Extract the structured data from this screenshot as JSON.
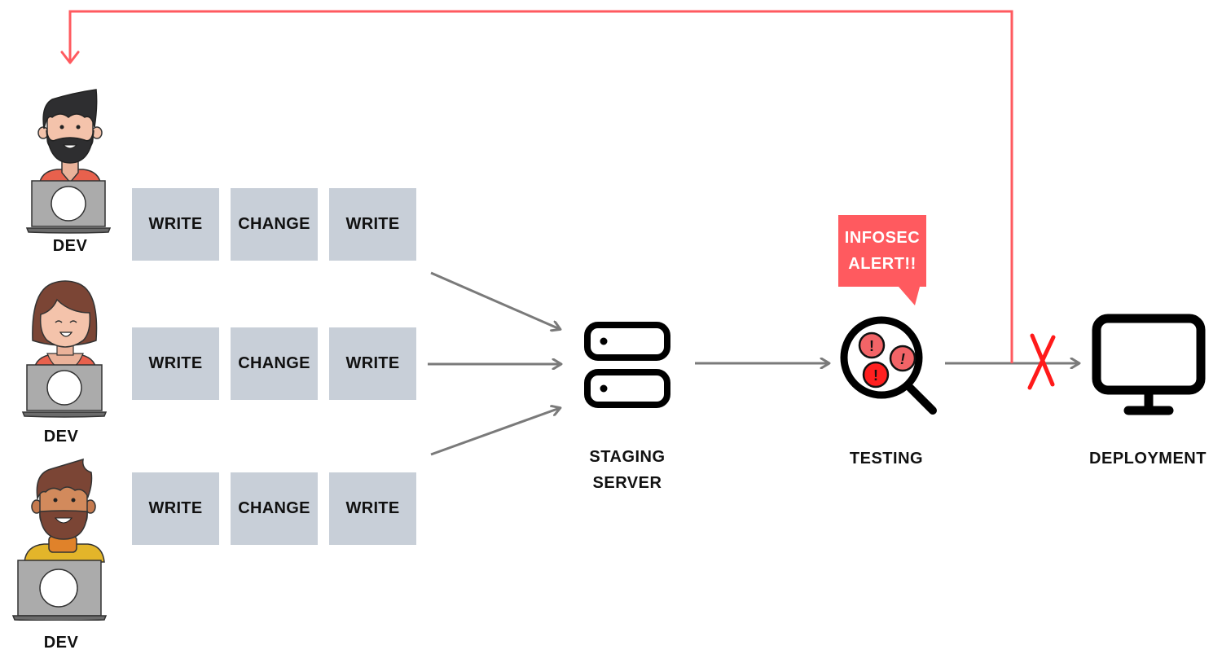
{
  "diagram": {
    "title": "",
    "developers": [
      {
        "label": "DEV",
        "avatar": "bearded-man-dark-hair",
        "shirt_color": "#e8614d",
        "tasks": [
          "WRITE",
          "CHANGE",
          "WRITE"
        ]
      },
      {
        "label": "DEV",
        "avatar": "woman-brown-hair",
        "shirt_color": "#e8614d",
        "tasks": [
          "WRITE",
          "CHANGE",
          "WRITE"
        ]
      },
      {
        "label": "DEV",
        "avatar": "bearded-man-brown-hair",
        "shirt_color": "#e3b52a",
        "tasks": [
          "WRITE",
          "CHANGE",
          "WRITE"
        ]
      }
    ],
    "stages": {
      "staging": {
        "line1": "STAGING",
        "line2": "SERVER",
        "icon": "server-icon"
      },
      "testing": {
        "label": "TESTING",
        "icon": "magnifier-alert-icon"
      },
      "deployment": {
        "label": "DEPLOYMENT",
        "icon": "monitor-icon"
      }
    },
    "alert": {
      "line1": "INFOSEC",
      "line2": "ALERT!!"
    },
    "feedback_loop": {
      "from": "testing",
      "to": "developers",
      "blocked_target": "deployment"
    },
    "colors": {
      "task_block": "#c8cfd8",
      "arrow": "#7a7a7a",
      "feedback": "#ff5a5f",
      "blocked_x": "#ff1a1a",
      "alert_bubble": "#ff5a5f",
      "alert_dot_light": "#f26467",
      "alert_dot_dark": "#ff1f1f"
    }
  }
}
